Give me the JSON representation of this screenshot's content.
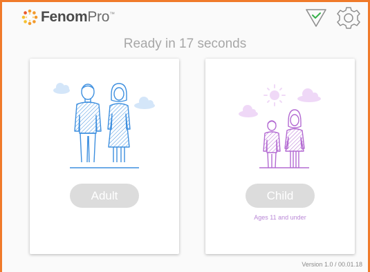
{
  "header": {
    "brand_bold": "Fenom",
    "brand_light": "Pro",
    "brand_tm": "™"
  },
  "status": {
    "ready_text": "Ready in 17 seconds"
  },
  "cards": {
    "adult": {
      "label": "Adult"
    },
    "child": {
      "label": "Child",
      "subtitle": "Ages 11 and under"
    }
  },
  "footer": {
    "version": "Version 1.0 / 00.01.18"
  },
  "colors": {
    "frame_accent": "#f07a2a",
    "adult_illustration": "#3d8fdf",
    "child_illustration": "#b36ad2",
    "button_gray": "#dcdcdc"
  },
  "icons": [
    "fenom-logo-icon",
    "status-check-icon",
    "settings-gear-icon"
  ]
}
